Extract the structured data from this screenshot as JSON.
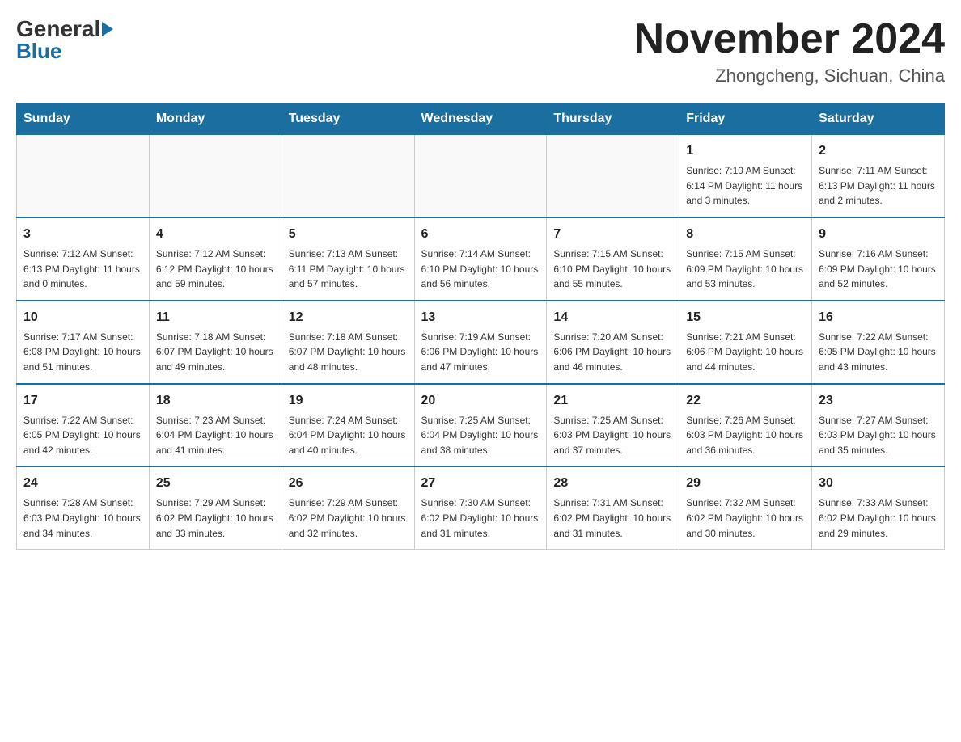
{
  "header": {
    "logo_general": "General",
    "logo_blue": "Blue",
    "month_title": "November 2024",
    "location": "Zhongcheng, Sichuan, China"
  },
  "weekdays": [
    "Sunday",
    "Monday",
    "Tuesday",
    "Wednesday",
    "Thursday",
    "Friday",
    "Saturday"
  ],
  "weeks": [
    [
      {
        "day": "",
        "info": ""
      },
      {
        "day": "",
        "info": ""
      },
      {
        "day": "",
        "info": ""
      },
      {
        "day": "",
        "info": ""
      },
      {
        "day": "",
        "info": ""
      },
      {
        "day": "1",
        "info": "Sunrise: 7:10 AM\nSunset: 6:14 PM\nDaylight: 11 hours\nand 3 minutes."
      },
      {
        "day": "2",
        "info": "Sunrise: 7:11 AM\nSunset: 6:13 PM\nDaylight: 11 hours\nand 2 minutes."
      }
    ],
    [
      {
        "day": "3",
        "info": "Sunrise: 7:12 AM\nSunset: 6:13 PM\nDaylight: 11 hours\nand 0 minutes."
      },
      {
        "day": "4",
        "info": "Sunrise: 7:12 AM\nSunset: 6:12 PM\nDaylight: 10 hours\nand 59 minutes."
      },
      {
        "day": "5",
        "info": "Sunrise: 7:13 AM\nSunset: 6:11 PM\nDaylight: 10 hours\nand 57 minutes."
      },
      {
        "day": "6",
        "info": "Sunrise: 7:14 AM\nSunset: 6:10 PM\nDaylight: 10 hours\nand 56 minutes."
      },
      {
        "day": "7",
        "info": "Sunrise: 7:15 AM\nSunset: 6:10 PM\nDaylight: 10 hours\nand 55 minutes."
      },
      {
        "day": "8",
        "info": "Sunrise: 7:15 AM\nSunset: 6:09 PM\nDaylight: 10 hours\nand 53 minutes."
      },
      {
        "day": "9",
        "info": "Sunrise: 7:16 AM\nSunset: 6:09 PM\nDaylight: 10 hours\nand 52 minutes."
      }
    ],
    [
      {
        "day": "10",
        "info": "Sunrise: 7:17 AM\nSunset: 6:08 PM\nDaylight: 10 hours\nand 51 minutes."
      },
      {
        "day": "11",
        "info": "Sunrise: 7:18 AM\nSunset: 6:07 PM\nDaylight: 10 hours\nand 49 minutes."
      },
      {
        "day": "12",
        "info": "Sunrise: 7:18 AM\nSunset: 6:07 PM\nDaylight: 10 hours\nand 48 minutes."
      },
      {
        "day": "13",
        "info": "Sunrise: 7:19 AM\nSunset: 6:06 PM\nDaylight: 10 hours\nand 47 minutes."
      },
      {
        "day": "14",
        "info": "Sunrise: 7:20 AM\nSunset: 6:06 PM\nDaylight: 10 hours\nand 46 minutes."
      },
      {
        "day": "15",
        "info": "Sunrise: 7:21 AM\nSunset: 6:06 PM\nDaylight: 10 hours\nand 44 minutes."
      },
      {
        "day": "16",
        "info": "Sunrise: 7:22 AM\nSunset: 6:05 PM\nDaylight: 10 hours\nand 43 minutes."
      }
    ],
    [
      {
        "day": "17",
        "info": "Sunrise: 7:22 AM\nSunset: 6:05 PM\nDaylight: 10 hours\nand 42 minutes."
      },
      {
        "day": "18",
        "info": "Sunrise: 7:23 AM\nSunset: 6:04 PM\nDaylight: 10 hours\nand 41 minutes."
      },
      {
        "day": "19",
        "info": "Sunrise: 7:24 AM\nSunset: 6:04 PM\nDaylight: 10 hours\nand 40 minutes."
      },
      {
        "day": "20",
        "info": "Sunrise: 7:25 AM\nSunset: 6:04 PM\nDaylight: 10 hours\nand 38 minutes."
      },
      {
        "day": "21",
        "info": "Sunrise: 7:25 AM\nSunset: 6:03 PM\nDaylight: 10 hours\nand 37 minutes."
      },
      {
        "day": "22",
        "info": "Sunrise: 7:26 AM\nSunset: 6:03 PM\nDaylight: 10 hours\nand 36 minutes."
      },
      {
        "day": "23",
        "info": "Sunrise: 7:27 AM\nSunset: 6:03 PM\nDaylight: 10 hours\nand 35 minutes."
      }
    ],
    [
      {
        "day": "24",
        "info": "Sunrise: 7:28 AM\nSunset: 6:03 PM\nDaylight: 10 hours\nand 34 minutes."
      },
      {
        "day": "25",
        "info": "Sunrise: 7:29 AM\nSunset: 6:02 PM\nDaylight: 10 hours\nand 33 minutes."
      },
      {
        "day": "26",
        "info": "Sunrise: 7:29 AM\nSunset: 6:02 PM\nDaylight: 10 hours\nand 32 minutes."
      },
      {
        "day": "27",
        "info": "Sunrise: 7:30 AM\nSunset: 6:02 PM\nDaylight: 10 hours\nand 31 minutes."
      },
      {
        "day": "28",
        "info": "Sunrise: 7:31 AM\nSunset: 6:02 PM\nDaylight: 10 hours\nand 31 minutes."
      },
      {
        "day": "29",
        "info": "Sunrise: 7:32 AM\nSunset: 6:02 PM\nDaylight: 10 hours\nand 30 minutes."
      },
      {
        "day": "30",
        "info": "Sunrise: 7:33 AM\nSunset: 6:02 PM\nDaylight: 10 hours\nand 29 minutes."
      }
    ]
  ]
}
